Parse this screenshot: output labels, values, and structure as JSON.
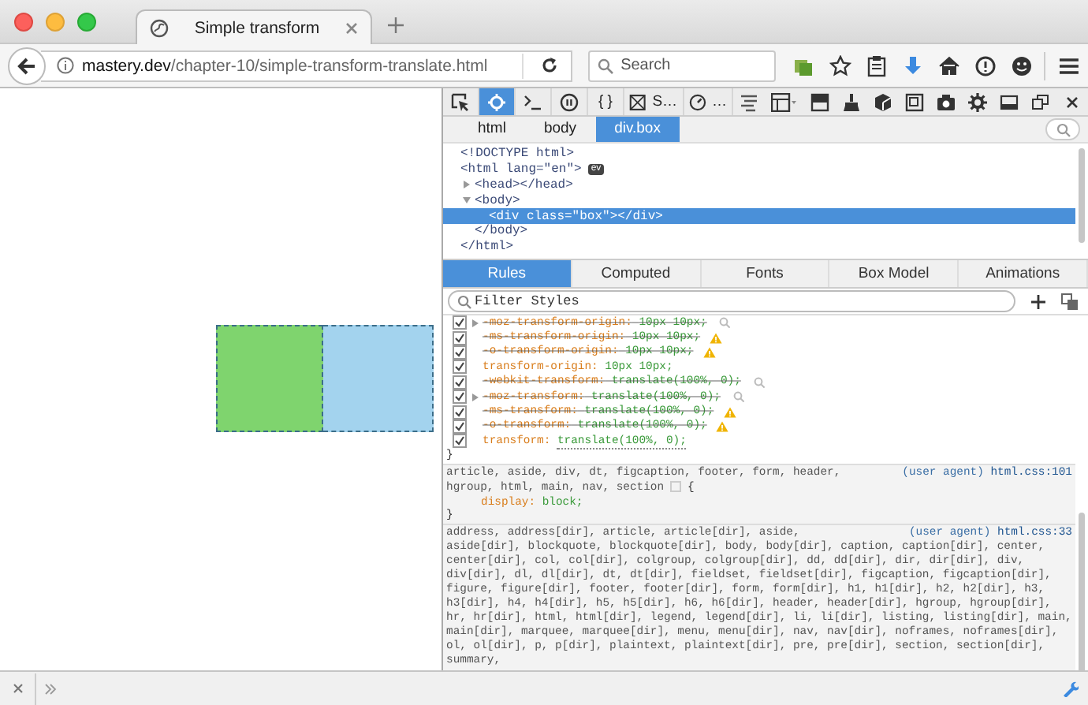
{
  "browser_tab": {
    "title": "Simple transform",
    "selected": true
  },
  "address_bar": {
    "host": "mastery.dev",
    "path": "/chapter-10/simple-transform-translate.html"
  },
  "search": {
    "placeholder": "Search"
  },
  "devtools": {
    "tools": [
      {
        "selected": false
      },
      {
        "selected": true
      },
      {
        "selected": false
      },
      {
        "selected": false
      },
      {
        "label": "{ }",
        "selected": false
      },
      {
        "label": "S…",
        "selected": false
      },
      {
        "label": "…",
        "selected": false
      }
    ],
    "breadcrumbs": [
      {
        "label": "html",
        "selected": false
      },
      {
        "label": "body",
        "selected": false
      },
      {
        "label": "div.box",
        "selected": true
      }
    ],
    "markup": [
      {
        "text": "<!DOCTYPE html>",
        "selected": false
      },
      {
        "text": "<html lang=\"en\">",
        "selected": false,
        "badge": "ev",
        "closing": "</html>",
        "children": [
          {
            "text": "<head></head>",
            "selected": false,
            "expanded": false
          },
          {
            "text": "<body>",
            "selected": false,
            "expanded": true,
            "closing": "</body>",
            "children": [
              {
                "text": "<div class=\"box\"></div>",
                "selected": true
              }
            ]
          }
        ]
      }
    ],
    "panel_tabs": [
      {
        "label": "Rules",
        "selected": true
      },
      {
        "label": "Computed",
        "selected": false
      },
      {
        "label": "Fonts",
        "selected": false
      },
      {
        "label": "Box Model",
        "selected": false
      },
      {
        "label": "Animations",
        "selected": false
      }
    ],
    "filter": {
      "placeholder": "Filter Styles"
    },
    "rules": [
      {
        "kind": "element",
        "declarations": [
          {
            "property": "-moz-transform-origin:",
            "value": "10px 10px;",
            "checked": true,
            "overridden": true,
            "expander": true,
            "inspect": true
          },
          {
            "property": "-ms-transform-origin:",
            "value": "10px 10px;",
            "checked": true,
            "overridden": true,
            "warning": true
          },
          {
            "property": "-o-transform-origin:",
            "value": "10px 10px;",
            "checked": true,
            "overridden": true,
            "warning": true
          },
          {
            "property": "transform-origin:",
            "value": "10px 10px;",
            "checked": true,
            "overridden": false
          },
          {
            "property": "-webkit-transform:",
            "value": "translate(100%, 0);",
            "checked": true,
            "overridden": true,
            "inspect": true
          },
          {
            "property": "-moz-transform:",
            "value": "translate(100%, 0);",
            "checked": true,
            "overridden": true,
            "expander": true,
            "inspect": true
          },
          {
            "property": "-ms-transform:",
            "value": "translate(100%, 0);",
            "checked": true,
            "overridden": true,
            "warning": true
          },
          {
            "property": "-o-transform:",
            "value": "translate(100%, 0);",
            "checked": true,
            "overridden": true,
            "warning": true
          },
          {
            "property": "transform:",
            "value": "translate(100%, 0);",
            "checked": true,
            "overridden": false
          }
        ],
        "close": "}"
      },
      {
        "kind": "user_agent",
        "source_origin": "(user agent)",
        "source_file": "html.css:101",
        "selector": [
          "article, aside, div, dt, figcaption, footer, form, header,",
          "hgroup, html, main, nav, section"
        ],
        "open": "{",
        "declarations": [
          {
            "property": "display:",
            "value": "block;"
          }
        ],
        "close": "}"
      },
      {
        "kind": "user_agent",
        "source_origin": "(user agent)",
        "source_file": "html.css:33",
        "selector": [
          "address, address[dir], article, article[dir], aside,",
          "aside[dir], blockquote, blockquote[dir], body, body[dir], caption, caption[dir], center, center[dir], col, col[dir], colgroup, colgroup[dir], dd, dd[dir], dir, dir[dir], div, div[dir], dl, dl[dir], dt, dt[dir], fieldset, fieldset[dir], figcaption, figcaption[dir], figure, figure[dir], footer, footer[dir], form, form[dir], h1, h1[dir], h2, h2[dir], h3, h3[dir], h4, h4[dir], h5, h5[dir], h6, h6[dir], header, header[dir], hgroup, hgroup[dir], hr, hr[dir], html, html[dir], legend, legend[dir], li, li[dir], listing, listing[dir], main, main[dir], marquee, marquee[dir], menu, menu[dir], nav, nav[dir], noframes, noframes[dir], ol, ol[dir], p, p[dir], plaintext, plaintext[dir], pre, pre[dir], section, section[dir], summary,"
        ]
      }
    ]
  }
}
